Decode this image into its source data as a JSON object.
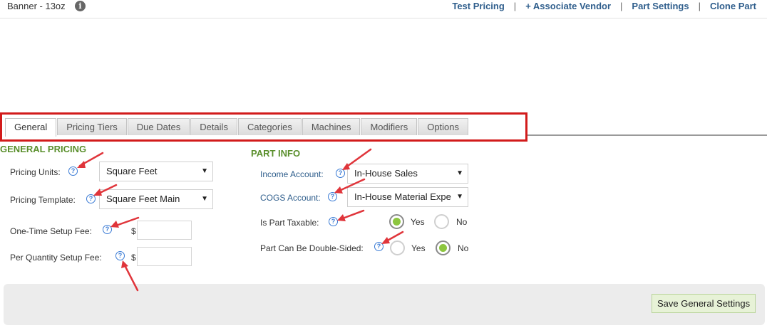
{
  "header": {
    "title": "Banner - 13oz",
    "info_icon": "i",
    "links": [
      "Test Pricing",
      "+ Associate Vendor",
      "Part Settings",
      "Clone Part"
    ],
    "separator": "|"
  },
  "tabs": [
    {
      "label": "General",
      "active": true
    },
    {
      "label": "Pricing Tiers",
      "active": false
    },
    {
      "label": "Due Dates",
      "active": false
    },
    {
      "label": "Details",
      "active": false
    },
    {
      "label": "Categories",
      "active": false
    },
    {
      "label": "Machines",
      "active": false
    },
    {
      "label": "Modifiers",
      "active": false
    },
    {
      "label": "Options",
      "active": false
    }
  ],
  "general_pricing": {
    "title": "GENERAL PRICING",
    "pricing_units_label": "Pricing Units:",
    "pricing_units_value": "Square Feet",
    "pricing_template_label": "Pricing Template:",
    "pricing_template_value": "Square Feet Main",
    "setup_fee_label": "One-Time Setup Fee:",
    "setup_fee_value": "",
    "per_qty_fee_label": "Per Quantity Setup Fee:",
    "per_qty_fee_value": "",
    "currency": "$"
  },
  "part_info": {
    "title": "PART INFO",
    "income_account_label": "Income Account:",
    "income_account_value": "In-House Sales",
    "cogs_account_label": "COGS Account:",
    "cogs_account_value": "In-House Material Expe",
    "taxable_label": "Is Part Taxable:",
    "taxable_value": "Yes",
    "double_sided_label": "Part Can Be Double-Sided:",
    "double_sided_value": "No",
    "yes_label": "Yes",
    "no_label": "No"
  },
  "help_icon": "?",
  "caret": "▼",
  "footer": {
    "save_label": "Save General Settings"
  },
  "colors": {
    "accent_green": "#5a8f2c",
    "link_blue": "#2f5e8c",
    "highlight_red": "#d21b1b",
    "radio_green": "#8dc63f"
  }
}
